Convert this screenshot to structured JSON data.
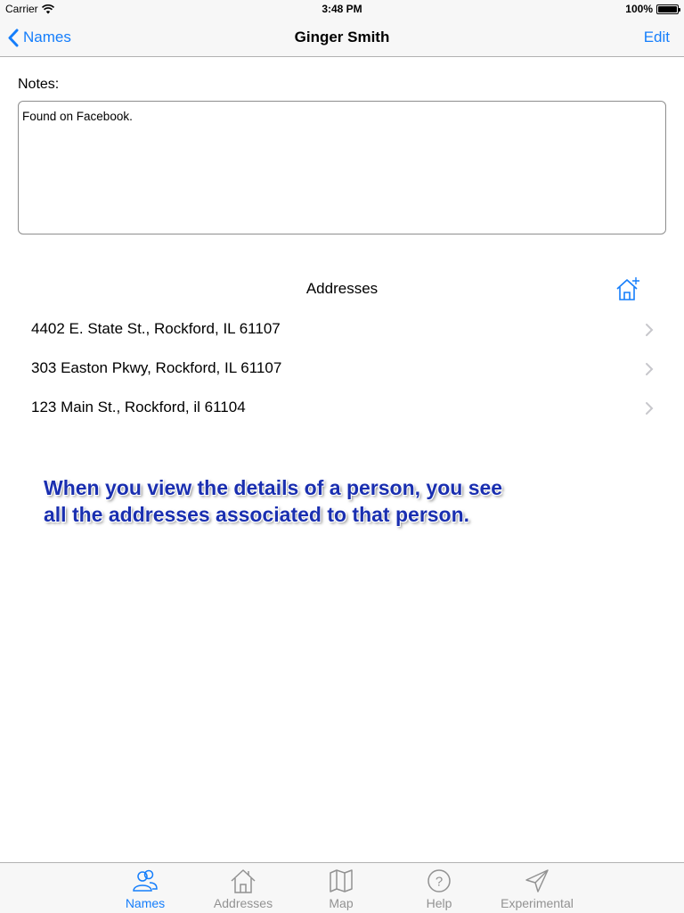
{
  "status_bar": {
    "carrier": "Carrier",
    "time": "3:48 PM",
    "battery": "100%"
  },
  "nav": {
    "back_label": "Names",
    "title": "Ginger Smith",
    "edit_label": "Edit"
  },
  "notes": {
    "label": "Notes:",
    "value": "Found on Facebook."
  },
  "addresses": {
    "header": "Addresses",
    "add_icon": "add-house-icon",
    "items": [
      {
        "text": "4402 E. State St., Rockford, IL 61107"
      },
      {
        "text": "303 Easton Pkwy, Rockford, IL 61107"
      },
      {
        "text": "123 Main St., Rockford, il 61104"
      }
    ]
  },
  "annotation": {
    "line1": "When you view the details of a person, you see",
    "line2": "all the addresses associated to that person."
  },
  "tabs": [
    {
      "label": "Names",
      "icon": "people-icon",
      "active": true
    },
    {
      "label": "Addresses",
      "icon": "house-icon",
      "active": false
    },
    {
      "label": "Map",
      "icon": "map-icon",
      "active": false
    },
    {
      "label": "Help",
      "icon": "help-icon",
      "active": false
    },
    {
      "label": "Experimental",
      "icon": "paper-plane-icon",
      "active": false
    }
  ],
  "colors": {
    "accent": "#157efb",
    "inactive": "#929292",
    "annotation": "#1a2fb0",
    "bar_bg": "#f7f7f7"
  }
}
